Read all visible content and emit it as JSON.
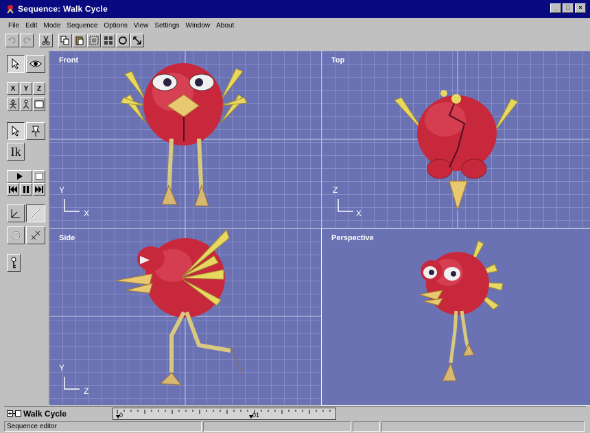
{
  "window": {
    "title": "Sequence: Walk Cycle"
  },
  "menu": [
    "File",
    "Edit",
    "Mode",
    "Sequence",
    "Options",
    "View",
    "Settings",
    "Window",
    "About"
  ],
  "toolbar": {
    "buttons": [
      "undo-icon",
      "redo-icon",
      "cut-icon",
      "copy-icon",
      "paste-icon",
      "select-all-icon",
      "grid-icon",
      "rotate-view-icon",
      "move-view-icon"
    ]
  },
  "tools": {
    "axis_x": "X",
    "axis_y": "Y",
    "axis_z": "Z",
    "ik": "Ik"
  },
  "viewports": {
    "front": {
      "label": "Front",
      "axis_v": "Y",
      "axis_h": "X"
    },
    "top": {
      "label": "Top",
      "axis_v": "Z",
      "axis_h": "X"
    },
    "side": {
      "label": "Side",
      "axis_v": "Y",
      "axis_h": "Z"
    },
    "perspective": {
      "label": "Perspective"
    }
  },
  "timeline": {
    "title": "Walk Cycle",
    "tick_0": "0",
    "tick_1": "01"
  },
  "status": {
    "text": "Sequence editor"
  }
}
